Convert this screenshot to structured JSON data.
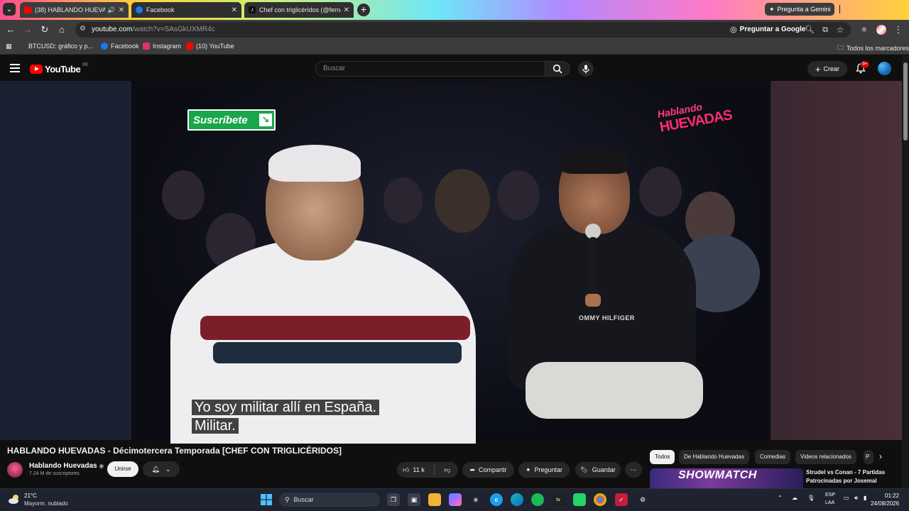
{
  "browser": {
    "tabs": [
      {
        "label": "(38) HABLANDO HUEVADAS",
        "favicon_color": "#ff0000"
      },
      {
        "label": "Facebook",
        "favicon_color": "#1877f2"
      },
      {
        "label": "Chef con triglicéridos (@fernan",
        "favicon_color": "#111111"
      }
    ],
    "gemini_label": "Pregunta a Gemini",
    "url_main": "youtube.com",
    "url_rest": "/watch?v=SAsGkUXMR4c",
    "ask_google": "Preguntar a Google",
    "bookmarks": [
      {
        "label": "BTCUSD: gráfico y p...",
        "color": "#1e1e1e"
      },
      {
        "label": "Facebook",
        "color": "#1877f2"
      },
      {
        "label": "Instagram",
        "color": "#e1306c"
      },
      {
        "label": "(10) YouTube",
        "color": "#ff0000"
      }
    ],
    "all_bookmarks": "Todos los marcadores"
  },
  "youtube": {
    "logo_text": "YouTube",
    "region": "PE",
    "search_placeholder": "Buscar",
    "create_label": "Crear",
    "notif_badge": "9+"
  },
  "video": {
    "subscribe_overlay": "Suscríbete",
    "show_logo_top": "Hablando",
    "show_logo_bottom": "HUEVADAS",
    "shirt_text": "OMMY HILFIGER",
    "caption_line1": "Yo soy militar allí en España.",
    "caption_line2": "Militar."
  },
  "meta": {
    "title": "HABLANDO HUEVADAS - Décimotercera Temporada [CHEF CON TRIGLICÉRIDOS]",
    "channel_name": "Hablando Huevadas",
    "subscribers": "7.24 M de suscriptores",
    "join_label": "Unirse",
    "likes": "11 k",
    "share_label": "Compartir",
    "ask_label": "Preguntar",
    "save_label": "Guardar"
  },
  "chips": [
    "Todos",
    "De Hablando Huevadas",
    "Comedias",
    "Videos relacionados",
    "P"
  ],
  "recommendation": {
    "thumb_text": "SHOWMATCH",
    "title": "Strudel vs Conan - 7 Partidas Patrocinadas por Josemal"
  },
  "taskbar": {
    "temperature": "21°C",
    "weather": "Mayorm. nublado",
    "search_label": "Buscar",
    "lang1": "ESP",
    "lang2": "LAA",
    "time": "01:22",
    "date": "24/08/2026"
  }
}
